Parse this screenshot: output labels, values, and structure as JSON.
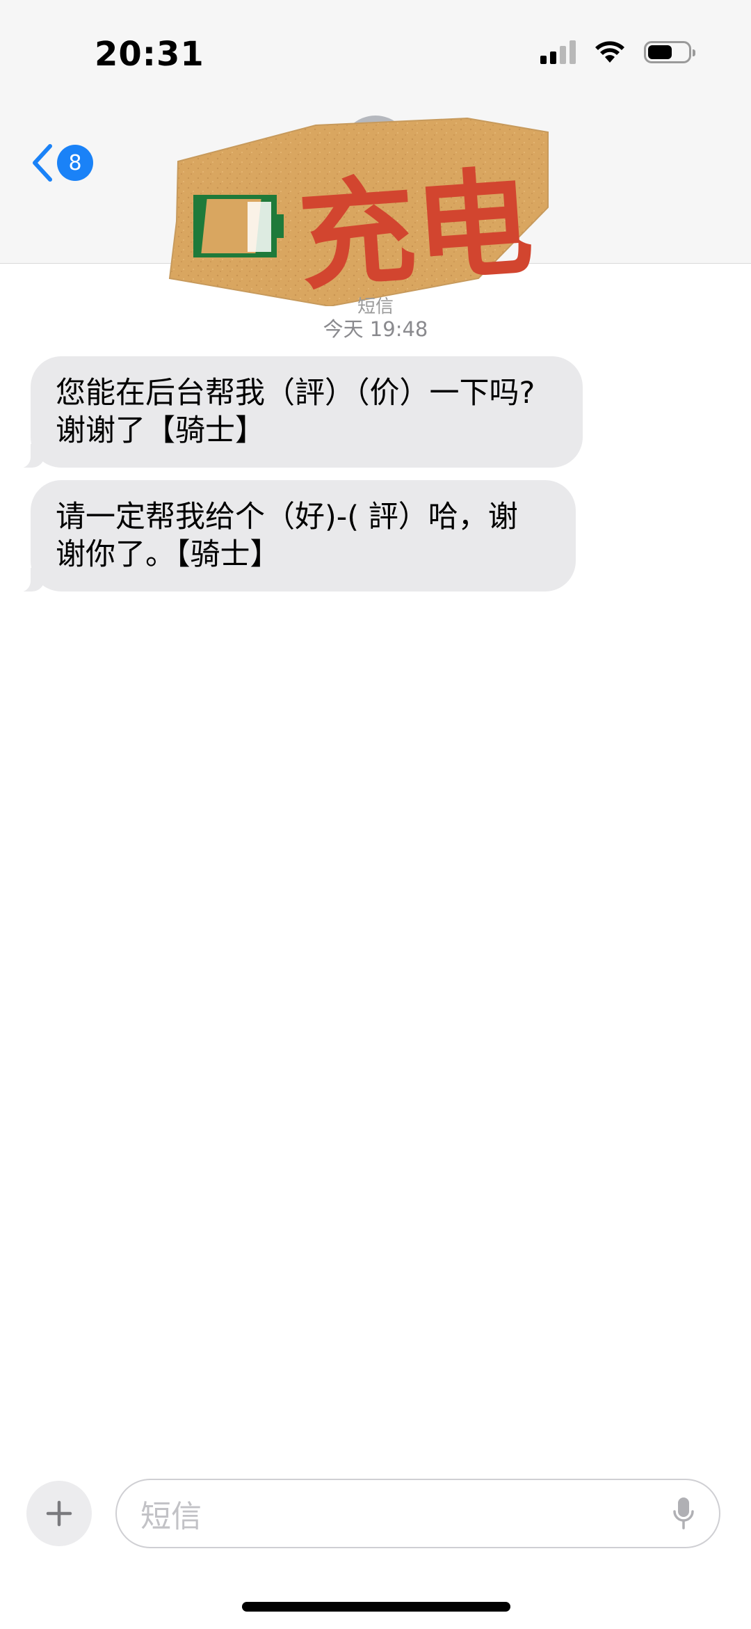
{
  "status_bar": {
    "time": "20:31",
    "battery_level": 0.6
  },
  "nav": {
    "back_icon": "chevron-left-icon",
    "unread_count": "8"
  },
  "sticker": {
    "text": "充电",
    "colors": {
      "card": "#d9a660",
      "battery": "#1f7a3a",
      "text": "#d2452f"
    }
  },
  "conversation": {
    "contact_name": "短信",
    "timestamp": "今天 19:48",
    "messages": [
      {
        "line1": "您能在后台帮我（評）（价）一下吗?",
        "line2": "谢谢了【骑士】"
      },
      {
        "line1": "请一定帮我给个（好)-( 評）哈，谢",
        "line2": "谢你了。【骑士】"
      }
    ]
  },
  "input_bar": {
    "placeholder": "短信",
    "plus_icon": "plus-icon",
    "mic_icon": "microphone-icon"
  },
  "colors": {
    "accent": "#1a82f7",
    "bubble_incoming": "#e9e9eb",
    "header_bg": "#f6f6f6"
  }
}
